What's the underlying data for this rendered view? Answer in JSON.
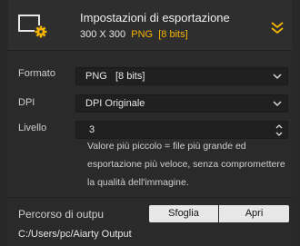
{
  "header": {
    "title": "Impostazioni di esportazione",
    "size": "300 X 300",
    "format": "PNG",
    "bits": "[8 bits]",
    "icon": "export-screen-gear-icon",
    "collapse_icon": "double-chevron-down-icon",
    "accent_color": "#f5b400"
  },
  "settings": {
    "format_label": "Formato",
    "format_value": "PNG   [8 bits]",
    "dpi_label": "DPI",
    "dpi_value": "DPI Originale",
    "level_label": "Livello",
    "level_value": "3",
    "note": "Valore più piccolo = file più grande ed esportazione più veloce, senza compromettere la qualità dell'immagine."
  },
  "output": {
    "label": "Percorso di outpu",
    "browse_label": "Sfoglia",
    "open_label": "Apri",
    "path": "C:/Users/pc/Aiarty Output"
  }
}
